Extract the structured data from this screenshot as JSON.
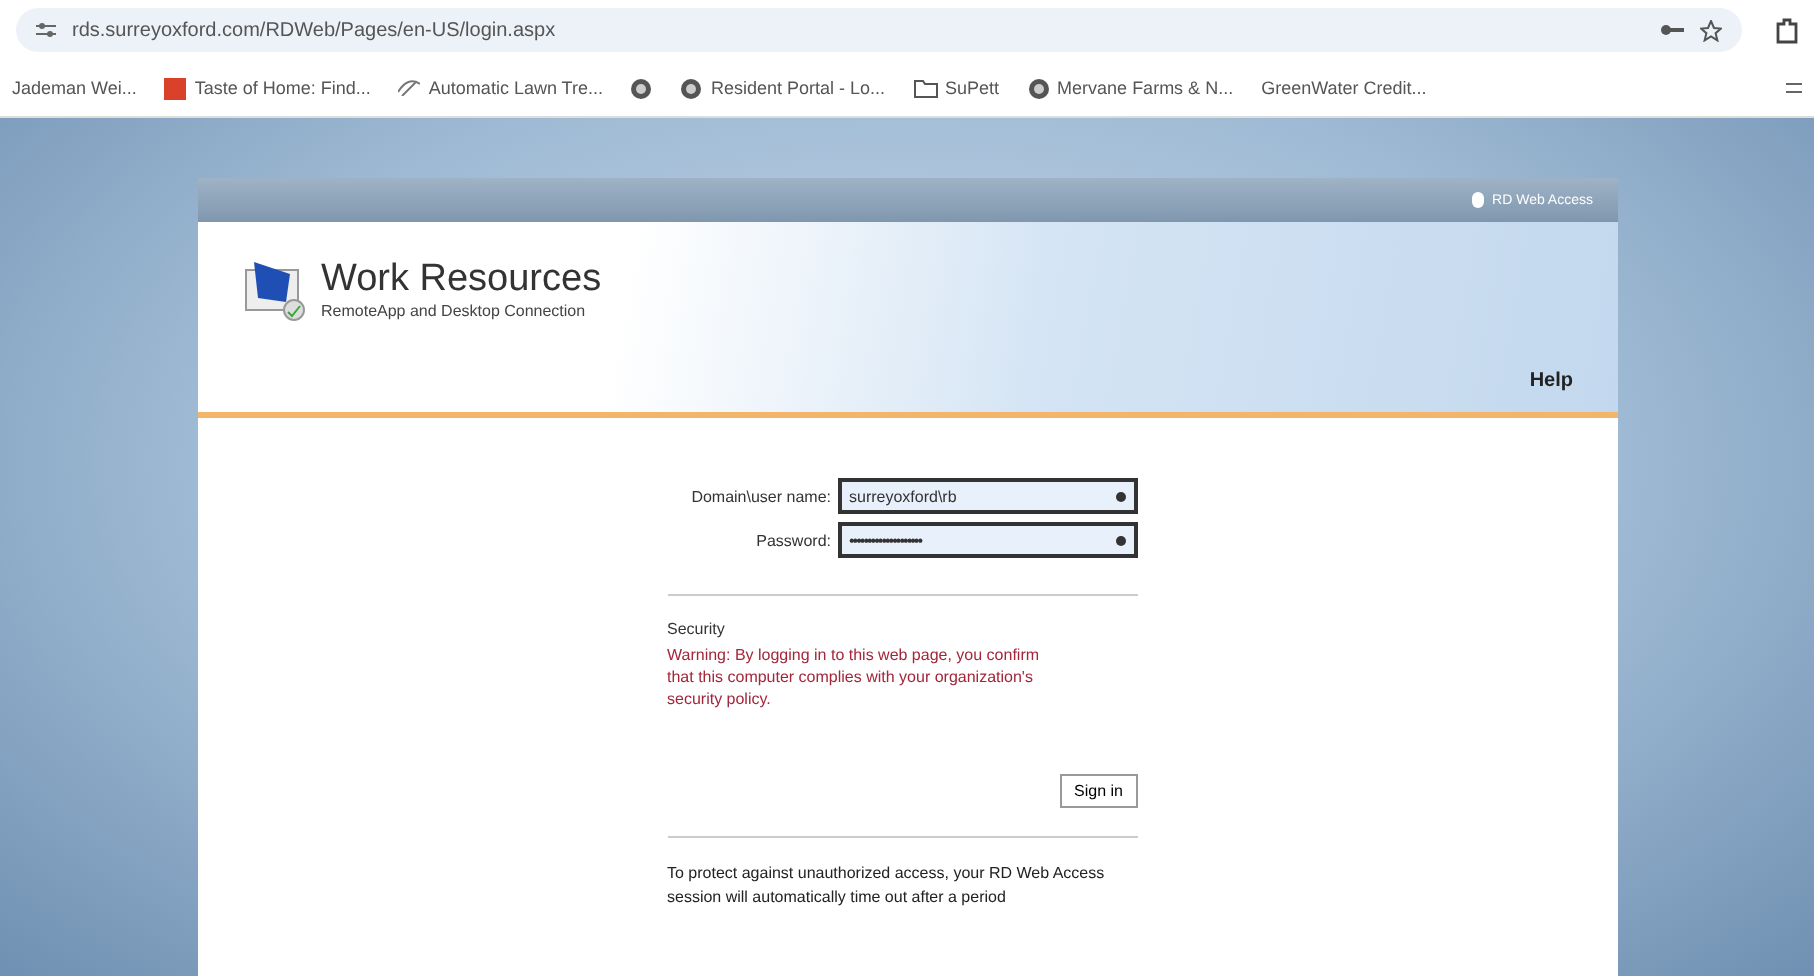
{
  "browser": {
    "url": "rds.surreyoxford.com/RDWeb/Pages/en-US/login.aspx",
    "bookmarks": [
      {
        "label": "Jademan Wei...",
        "kind": "none"
      },
      {
        "label": "Taste of Home: Find...",
        "kind": "tile"
      },
      {
        "label": "Automatic Lawn Tre...",
        "kind": "leaf"
      },
      {
        "kind": "globe"
      },
      {
        "label": "Resident Portal - Lo...",
        "kind": "globe"
      },
      {
        "label": "SuPett",
        "kind": "folder"
      },
      {
        "label": "Mervane Farms & N...",
        "kind": "globe"
      },
      {
        "label": "GreenWater Credit...",
        "kind": "none"
      }
    ]
  },
  "page": {
    "banner": "RD Web Access",
    "title": "Work Resources",
    "subtitle": "RemoteApp and Desktop Connection",
    "help": "Help",
    "fields": [
      {
        "label": "Domain\\user name:",
        "value": "surreyoxford\\rb",
        "kind": "text"
      },
      {
        "label": "Password:",
        "value": "••••••••••••••••••••",
        "kind": "password"
      }
    ],
    "security_heading": "Security",
    "warning": "Warning: By logging in to this web page, you confirm that this computer complies with your organization's security policy.",
    "sign_in": "Sign in",
    "notice": "To protect against unauthorized access, your RD Web Access session will automatically time out after a period"
  }
}
